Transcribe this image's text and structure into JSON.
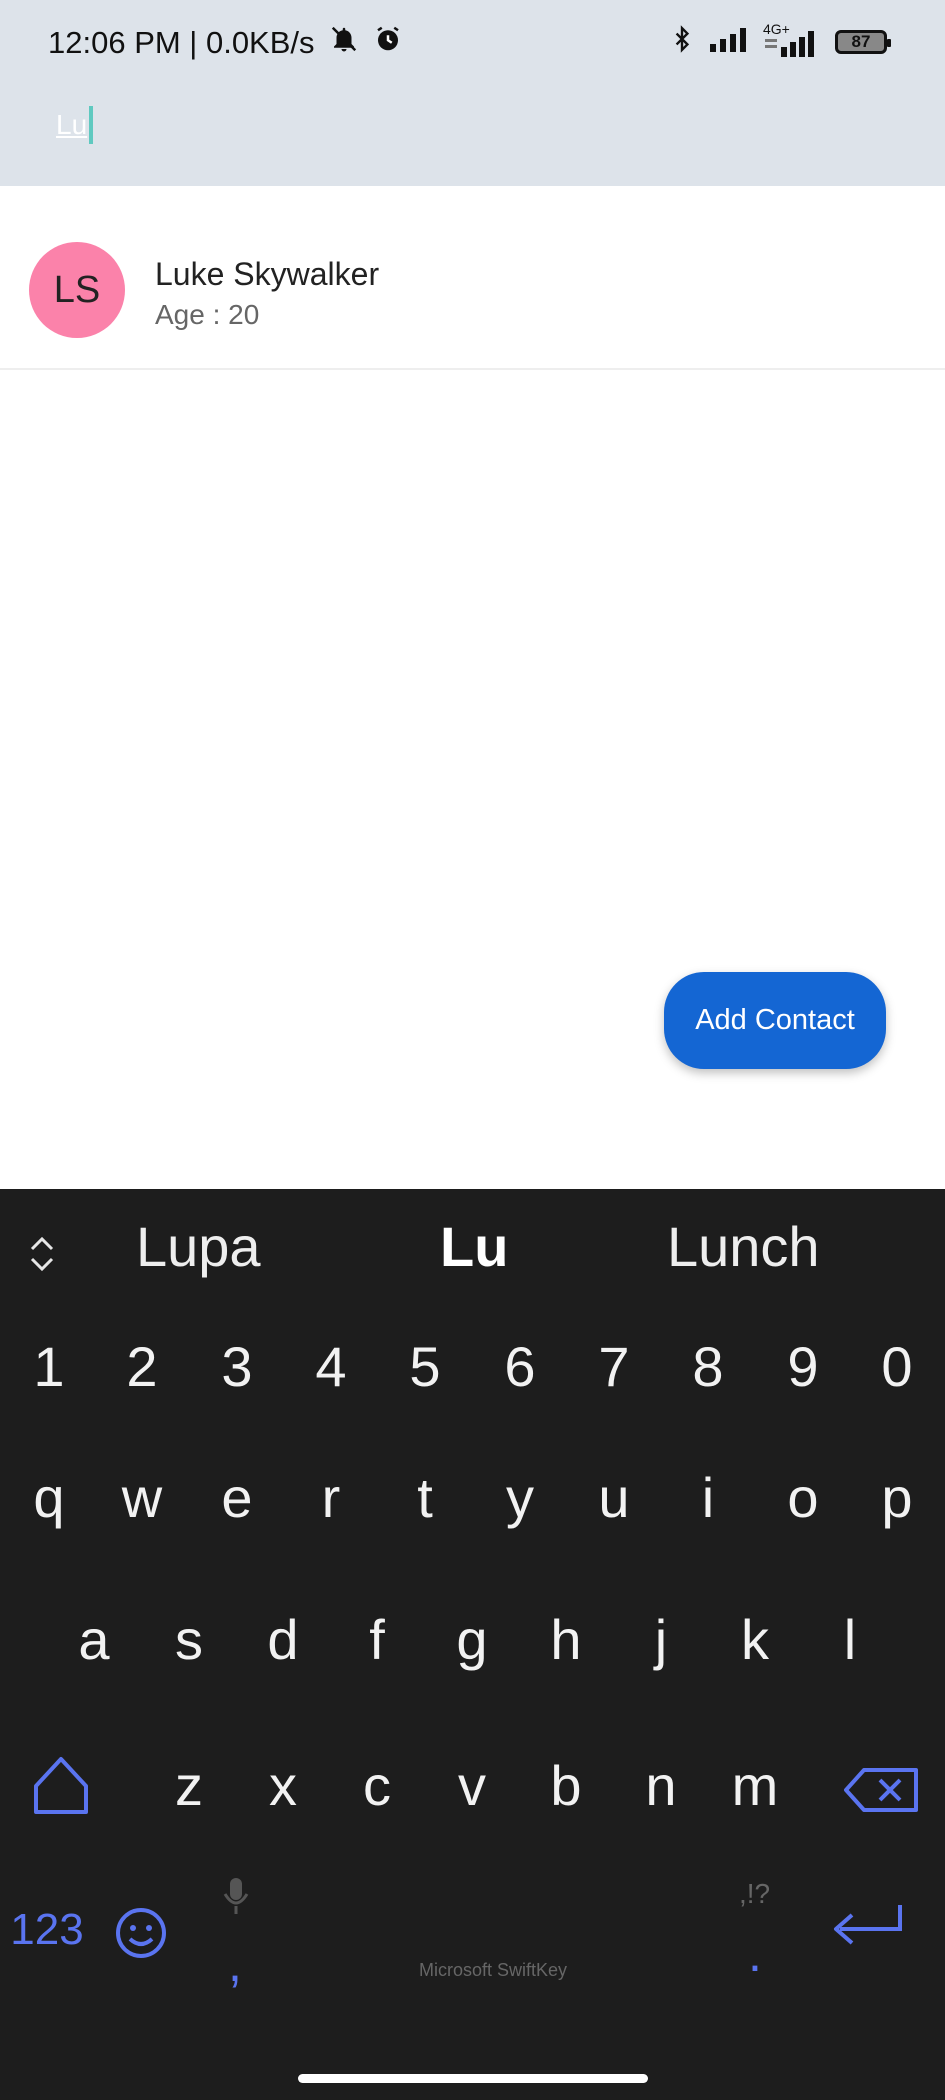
{
  "status_bar": {
    "time_speed": "12:06 PM | 0.0KB/s",
    "network_label": "4G+",
    "battery": "87",
    "icons": [
      "bell-muted-icon",
      "alarm-icon",
      "bluetooth-icon",
      "signal-icon",
      "battery-icon"
    ]
  },
  "search": {
    "value": "Lu"
  },
  "contacts": [
    {
      "initials": "LS",
      "name": "Luke Skywalker",
      "age": "Age : 20",
      "avatar_color": "#fb82aa"
    }
  ],
  "fab": {
    "label": "Add Contact",
    "color": "#1466d3"
  },
  "keyboard": {
    "suggestions": [
      "Lupa",
      "Lu",
      "Lunch"
    ],
    "row_numbers": [
      "1",
      "2",
      "3",
      "4",
      "5",
      "6",
      "7",
      "8",
      "9",
      "0"
    ],
    "row_q": [
      "q",
      "w",
      "e",
      "r",
      "t",
      "y",
      "u",
      "i",
      "o",
      "p"
    ],
    "row_a": [
      "a",
      "s",
      "d",
      "f",
      "g",
      "h",
      "j",
      "k",
      "l"
    ],
    "row_z": [
      "z",
      "x",
      "c",
      "v",
      "b",
      "n",
      "m"
    ],
    "numbers_key": "123",
    "comma_key": ",",
    "period_key": ".",
    "punct_hint": ",!?",
    "brand": "Microsoft SwiftKey",
    "accent_color": "#5a74f0"
  }
}
